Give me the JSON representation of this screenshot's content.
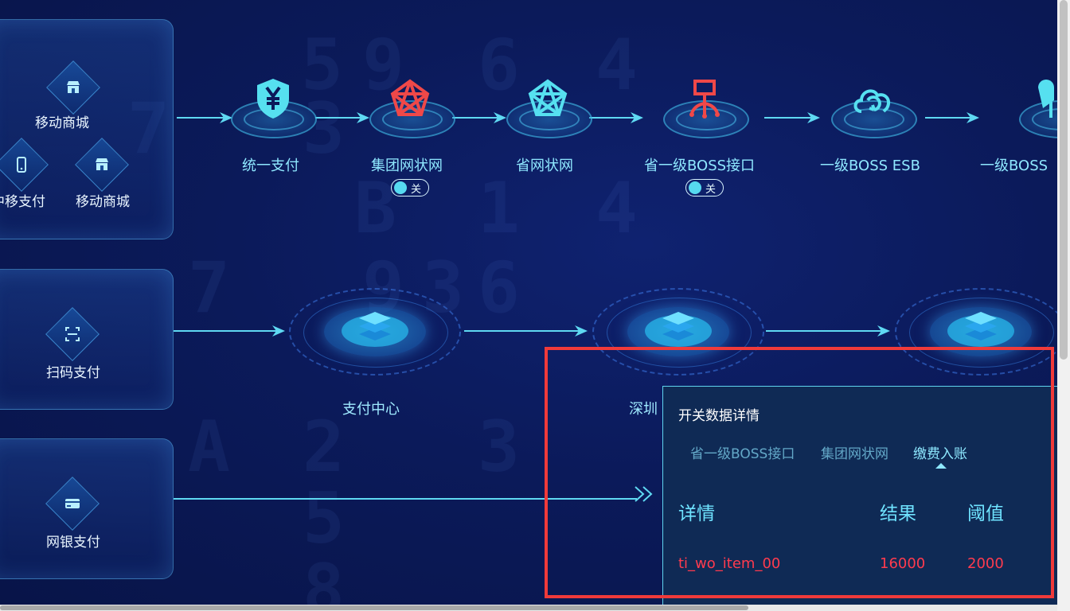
{
  "background_digits": [
    "5",
    "9",
    "6",
    "4",
    "7",
    "3",
    "B",
    "1",
    "4",
    "9",
    "3",
    "6",
    "7",
    "A",
    "2",
    "3",
    "5",
    "8"
  ],
  "channels": {
    "top": [
      {
        "label": "移动商城",
        "icon": "store-icon"
      },
      {
        "label": "中移支付",
        "icon": "mobile-phone-icon"
      },
      {
        "label": "移动商城",
        "icon": "store-icon"
      }
    ],
    "scan": {
      "label": "扫码支付",
      "icon": "scan-icon"
    },
    "bank": {
      "label": "网银支付",
      "icon": "bank-card-icon"
    }
  },
  "pipeline": [
    {
      "label": "统一支付",
      "icon": "yuan-shield-icon",
      "color": "#56e0f0"
    },
    {
      "label": "集团网状网",
      "icon": "mesh-network-icon",
      "color": "#f04848",
      "toggle": "关"
    },
    {
      "label": "省网状网",
      "icon": "mesh-network-icon",
      "color": "#56e0f0"
    },
    {
      "label": "省一级BOSS接口",
      "icon": "interface-tree-icon",
      "color": "#f04848",
      "toggle": "关"
    },
    {
      "label": "一级BOSS ESB",
      "icon": "cloud-sync-icon",
      "color": "#56e0f0"
    },
    {
      "label": "一级BOSS",
      "icon": "partial-icon",
      "color": "#56e0f0"
    }
  ],
  "hubs": [
    {
      "label": "支付中心"
    },
    {
      "label": "深圳"
    },
    {
      "label": ""
    }
  ],
  "popup": {
    "title": "开关数据详情",
    "tabs": [
      "省一级BOSS接口",
      "集团网状网",
      "缴费入账"
    ],
    "active_tab": "缴费入账",
    "columns": [
      "详情",
      "结果",
      "阈值"
    ],
    "rows": [
      [
        "ti_wo_item_00",
        "16000",
        "2000"
      ]
    ]
  },
  "colors": {
    "accent": "#56e0f0",
    "alert": "#f04848",
    "highlight_border": "#f03a3a",
    "value_red": "#ff3b4e"
  }
}
